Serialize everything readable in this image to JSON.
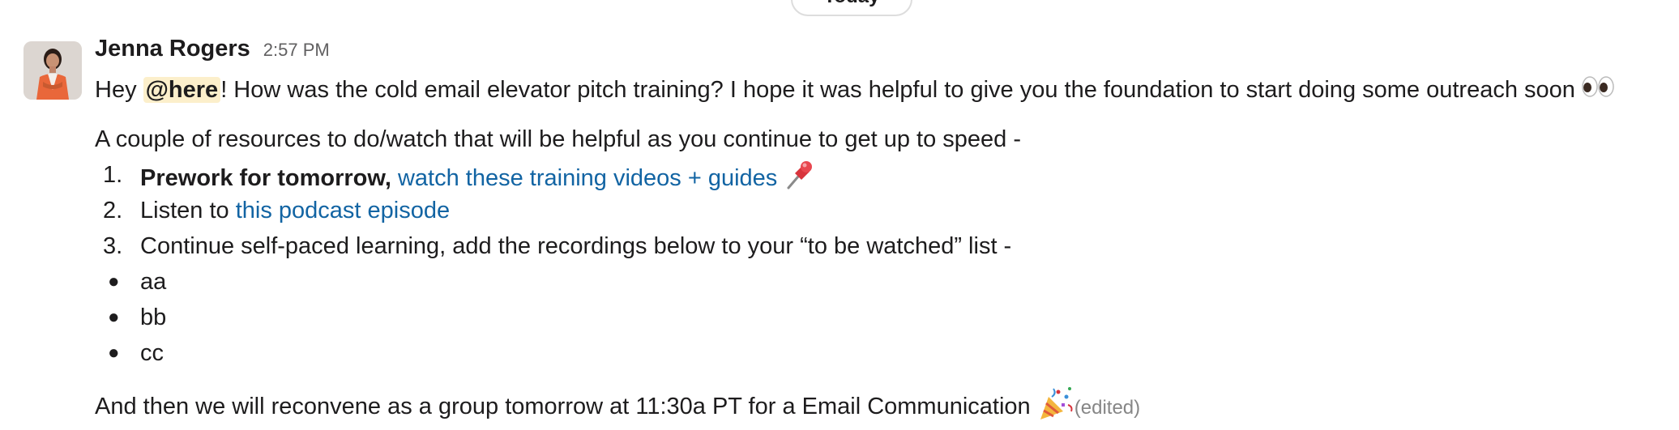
{
  "date_divider": {
    "label": "Today"
  },
  "message": {
    "sender": "Jenna Rogers",
    "time": "2:57 PM",
    "line1": {
      "pre": "Hey ",
      "mention": "@here",
      "post": "! How was the cold email elevator pitch training? I hope it was helpful to give you the foundation to start doing some outreach soon"
    },
    "intro": "A couple of resources to do/watch that will be helpful as you continue to get up to speed -",
    "list": [
      {
        "number": "1.",
        "bold": "Prework for tomorrow,",
        "link": "watch these training videos + guides"
      },
      {
        "number": "2.",
        "text": "Listen to ",
        "link": "this podcast episode"
      },
      {
        "number": "3.",
        "text": "Continue self-paced learning, add the recordings below  to your “to be watched” list -"
      }
    ],
    "bullets": [
      "aa",
      "bb",
      "cc"
    ],
    "closing": "And then we will reconvene as a group tomorrow at 11:30a PT for a Email Communication",
    "edited": "(edited)"
  },
  "icons": {
    "eyes": "eyes-emoji-icon",
    "pushpin": "pushpin-emoji-icon",
    "party": "party-popper-emoji-icon",
    "avatar": "user-avatar"
  },
  "colors": {
    "link": "#1264a3",
    "mention_bg": "#fcefcb",
    "muted": "#616061",
    "edited": "#868686"
  }
}
